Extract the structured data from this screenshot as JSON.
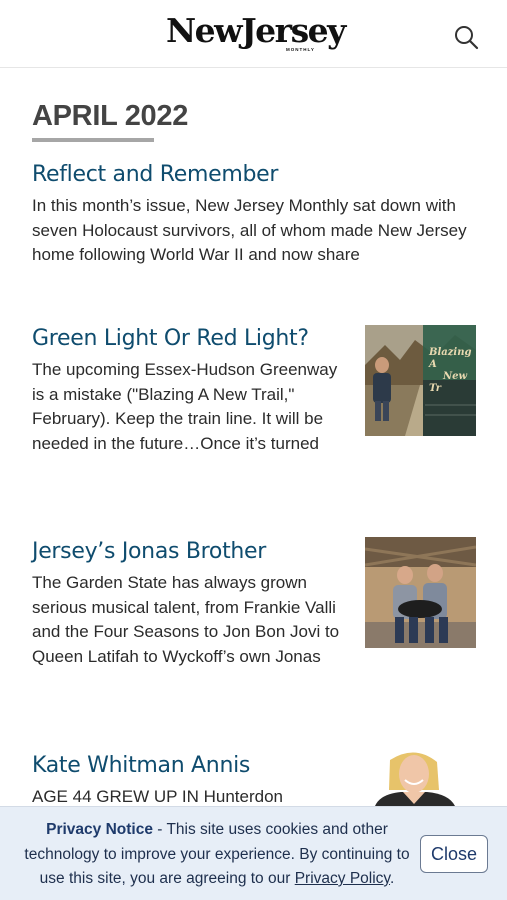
{
  "header": {
    "logo_text": "NewJersey",
    "logo_subtext": "MONTHLY",
    "search_icon": "search-icon"
  },
  "issue": {
    "title": "APRIL 2022"
  },
  "articles": [
    {
      "title": "Reflect and Remember",
      "excerpt": "In this month’s issue, New Jersey Monthly sat down with seven Holocaust survivors, all of whom made New Jersey home following World War II and now share"
    },
    {
      "title": "Green Light Or Red Light?",
      "excerpt": "The upcoming Essex-Hudson Greenway is a mistake (\"Blazing A New Trail,\" February). Keep the train line. It will be needed in the future…Once it’s turned",
      "thumb_caption_1": "Blazing A",
      "thumb_caption_2": "New Tr"
    },
    {
      "title": "Jersey’s Jonas Brother",
      "excerpt": "The Garden State has always grown serious musical talent, from Frankie Valli and the Four Seasons to Jon Bon Jovi to Queen Latifah to Wyckoff’s own Jonas"
    },
    {
      "title": "Kate Whitman Annis",
      "excerpt": "AGE 44 GREW UP IN Hunterdon"
    }
  ],
  "privacy": {
    "heading": "Privacy Notice",
    "text_before": " - This site uses cookies and other technology to improve your experience. By continuing to use this site, you are agreeing to our ",
    "link_label": "Privacy Policy",
    "text_after": ".",
    "close_label": "Close"
  },
  "colors": {
    "title_blue": "#0f4c6e",
    "notice_bg": "#e7eef7"
  }
}
